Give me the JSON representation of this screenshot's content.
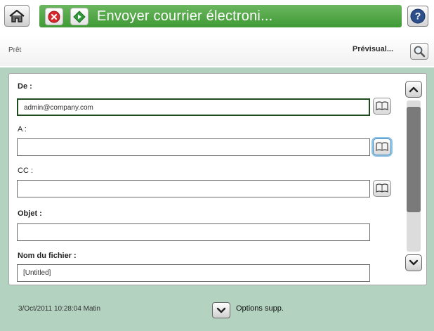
{
  "header": {
    "title": "Envoyer courrier électroni...",
    "home_icon": "home-icon",
    "stop_icon": "stop-icon",
    "start_icon": "start-icon",
    "help_icon": "help-icon"
  },
  "status": {
    "text": "Prêt",
    "preview_label": "Prévisual...",
    "preview_icon": "magnifier-icon"
  },
  "form": {
    "from": {
      "label": "De :",
      "value": "admin@company.com"
    },
    "to": {
      "label": "A :",
      "value": ""
    },
    "cc": {
      "label": "CC :",
      "value": ""
    },
    "subject": {
      "label": "Objet :",
      "value": ""
    },
    "filename": {
      "label": "Nom du fichier :",
      "value": "[Untitled]"
    },
    "address_book_icon": "address-book-icon"
  },
  "footer": {
    "datetime": "3/Oct/2011 10:28:04 Matin",
    "options_label": "Options supp."
  },
  "colors": {
    "title_bar": "#4ea744",
    "background": "#b3d3c0",
    "stop_red": "#d9262c",
    "start_green": "#2f9a3a",
    "help_blue": "#2c4f8a"
  }
}
